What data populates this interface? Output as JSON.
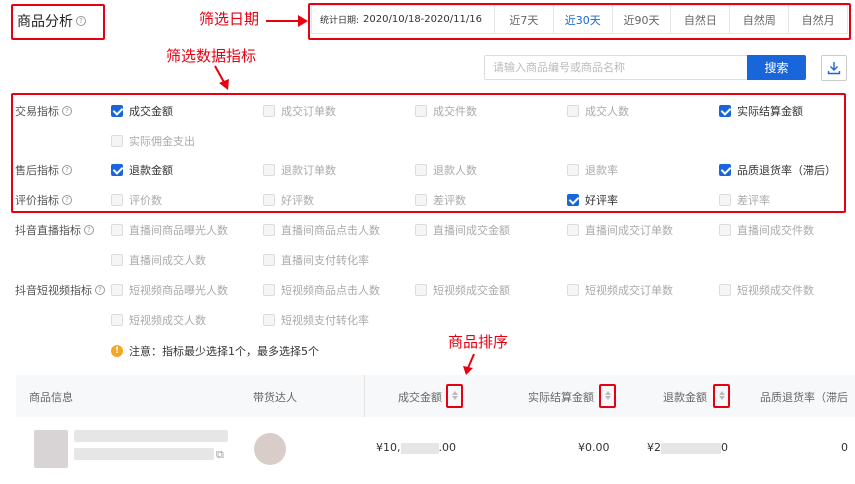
{
  "header": {
    "title": "商品分析",
    "date_range_label": "统计日期:",
    "date_range_value": "2020/10/18-2020/11/16",
    "date_tabs": [
      "近7天",
      "近30天",
      "近90天",
      "自然日",
      "自然周",
      "自然月"
    ],
    "active_tab": "近30天"
  },
  "annotations": {
    "date_filter": "筛选日期",
    "metric_filter": "筛选数据指标",
    "product_sort": "商品排序"
  },
  "search": {
    "placeholder": "请输入商品编号或商品名称",
    "button_label": "搜索"
  },
  "metric_groups": [
    {
      "label": "交易指标",
      "items": [
        {
          "label": "成交金额",
          "checked": true
        },
        {
          "label": "成交订单数",
          "checked": false
        },
        {
          "label": "成交件数",
          "checked": false
        },
        {
          "label": "成交人数",
          "checked": false
        },
        {
          "label": "实际结算金额",
          "checked": true
        },
        {
          "label": "实际佣金支出",
          "checked": false
        }
      ]
    },
    {
      "label": "售后指标",
      "items": [
        {
          "label": "退款金额",
          "checked": true
        },
        {
          "label": "退款订单数",
          "checked": false
        },
        {
          "label": "退款人数",
          "checked": false
        },
        {
          "label": "退款率",
          "checked": false
        },
        {
          "label": "品质退货率（滞后）",
          "checked": true
        }
      ]
    },
    {
      "label": "评价指标",
      "items": [
        {
          "label": "评价数",
          "checked": false
        },
        {
          "label": "好评数",
          "checked": false
        },
        {
          "label": "差评数",
          "checked": false
        },
        {
          "label": "好评率",
          "checked": true
        },
        {
          "label": "差评率",
          "checked": false
        }
      ]
    },
    {
      "label": "抖音直播指标",
      "items": [
        {
          "label": "直播间商品曝光人数",
          "checked": false
        },
        {
          "label": "直播间商品点击人数",
          "checked": false
        },
        {
          "label": "直播间成交金额",
          "checked": false
        },
        {
          "label": "直播间成交订单数",
          "checked": false
        },
        {
          "label": "直播间成交件数",
          "checked": false
        },
        {
          "label": "直播间成交人数",
          "checked": false
        },
        {
          "label": "直播间支付转化率",
          "checked": false
        }
      ]
    },
    {
      "label": "抖音短视频指标",
      "items": [
        {
          "label": "短视频商品曝光人数",
          "checked": false
        },
        {
          "label": "短视频商品点击人数",
          "checked": false
        },
        {
          "label": "短视频成交金额",
          "checked": false
        },
        {
          "label": "短视频成交订单数",
          "checked": false
        },
        {
          "label": "短视频成交件数",
          "checked": false
        },
        {
          "label": "短视频成交人数",
          "checked": false
        },
        {
          "label": "短视频支付转化率",
          "checked": false
        }
      ]
    }
  ],
  "notice": "注意：指标最少选择1个，最多选择5个",
  "table": {
    "columns": [
      "商品信息",
      "带货达人",
      "成交金额",
      "实际结算金额",
      "退款金额",
      "品质退货率（滞后"
    ],
    "row": {
      "gmv": "¥10,",
      "gmv_tail": ".00",
      "settlement": "¥0.00",
      "refund": "¥2",
      "refund_tail": "0",
      "last": "0"
    }
  },
  "colors": {
    "accent": "#1866d9",
    "annotation_red": "#e60012",
    "warning": "#f5a623"
  }
}
